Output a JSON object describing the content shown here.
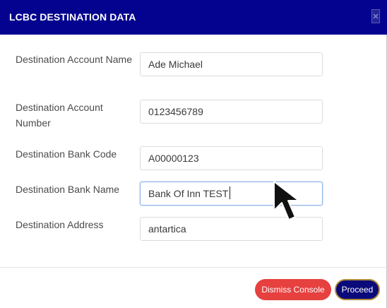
{
  "modal": {
    "title": "LCBC DESTINATION DATA",
    "close_icon": "close-icon"
  },
  "form": {
    "fields": [
      {
        "label": "Destination Account Name",
        "value": "Ade Michael"
      },
      {
        "label": "Destination Account Number",
        "value": "0123456789"
      },
      {
        "label": "Destination Bank Code",
        "value": "A00000123"
      },
      {
        "label": "Destination Bank Name",
        "value": "Bank Of Inn TEST"
      },
      {
        "label": "Destination Address",
        "value": "antartica"
      }
    ]
  },
  "footer": {
    "dismiss_label": "Dismiss Console",
    "proceed_label": "Proceed"
  },
  "colors": {
    "header_bg": "#03038f",
    "dismiss_bg": "#e6403f",
    "proceed_bg": "#0a0a7a"
  }
}
